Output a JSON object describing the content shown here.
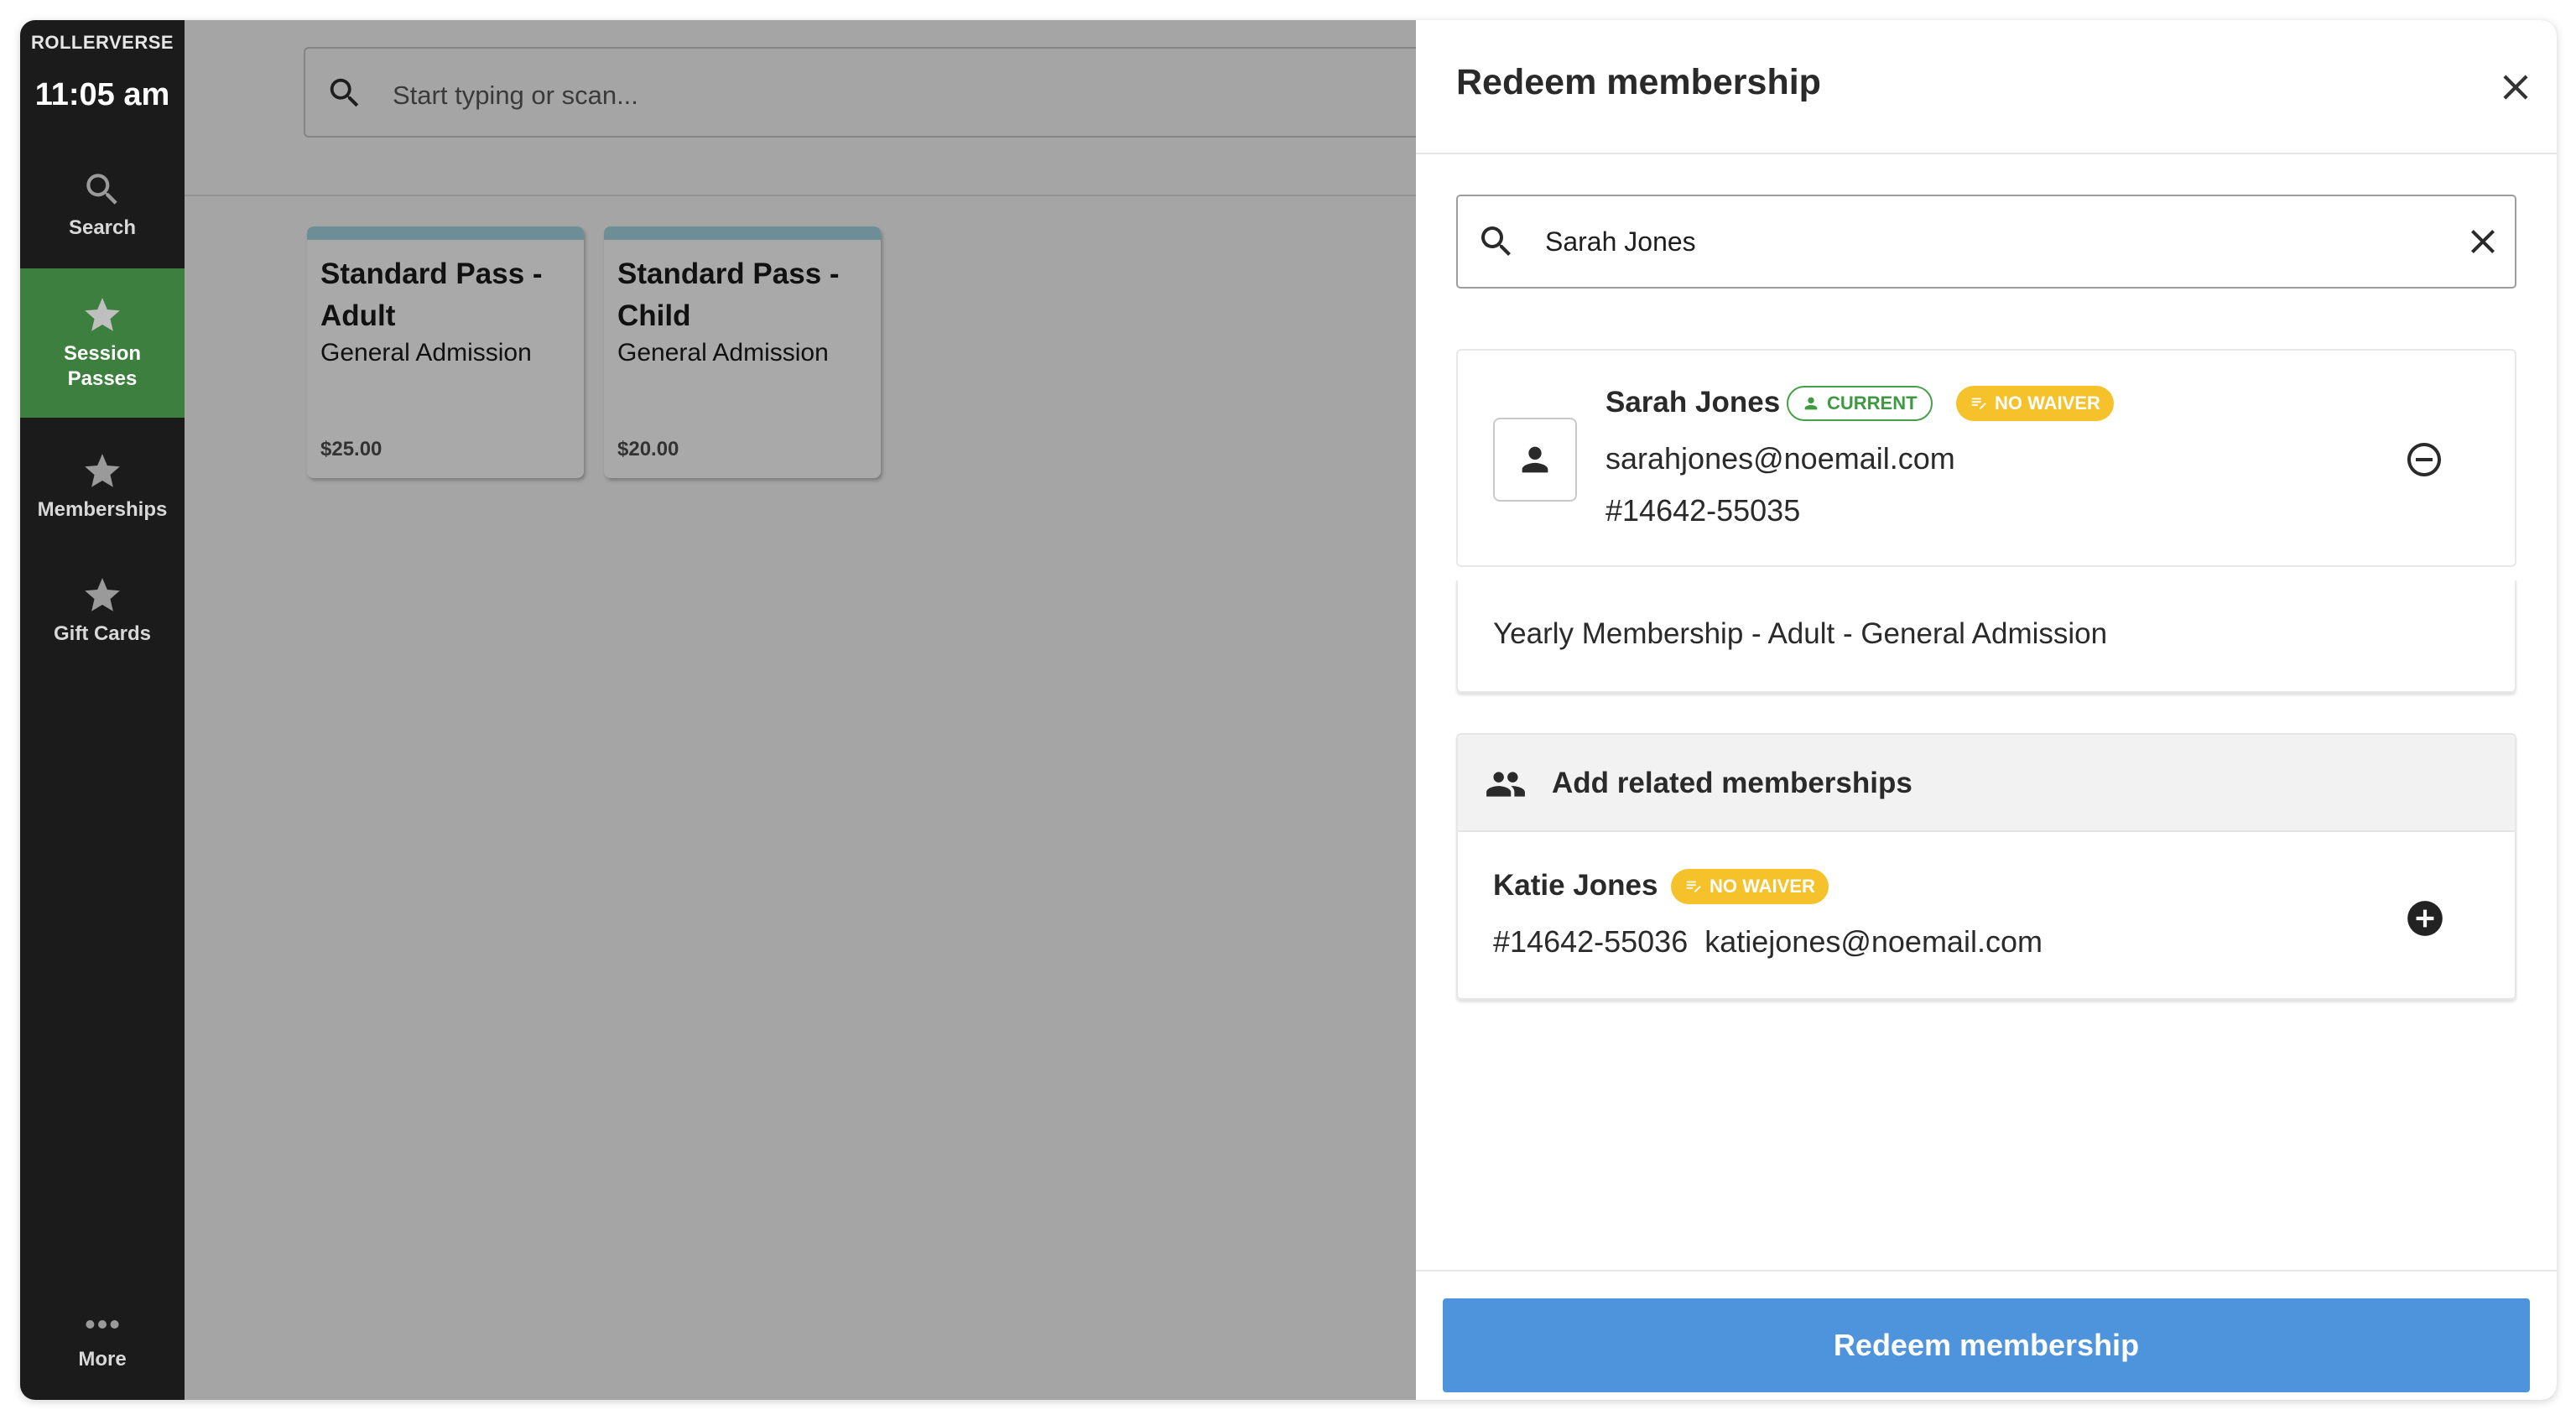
{
  "nav": {
    "brand": "ROLLERVERSE",
    "time": "11:05 am",
    "items": [
      {
        "label": "Search",
        "icon": "search-icon"
      },
      {
        "label": "Session Passes",
        "icon": "star-icon",
        "active": true
      },
      {
        "label": "Memberships",
        "icon": "star-icon"
      },
      {
        "label": "Gift Cards",
        "icon": "star-icon"
      }
    ],
    "more_label": "More"
  },
  "main": {
    "search_placeholder": "Start typing or scan...",
    "products": [
      {
        "name": "Standard Pass - Adult",
        "sub": "General Admission",
        "price": "$25.00"
      },
      {
        "name": "Standard Pass - Child",
        "sub": "General Admission",
        "price": "$20.00"
      }
    ]
  },
  "drawer": {
    "title": "Redeem membership",
    "search_value": "Sarah Jones",
    "member": {
      "name": "Sarah Jones",
      "badge_current": "CURRENT",
      "badge_waiver": "NO WAIVER",
      "email": "sarahjones@noemail.com",
      "id": "#14642-55035",
      "plan": "Yearly Membership - Adult - General Admission"
    },
    "related": {
      "heading": "Add related memberships",
      "items": [
        {
          "name": "Katie Jones",
          "badge": "NO WAIVER",
          "line": "#14642-55036  katiejones@noemail.com"
        }
      ]
    },
    "redeem_label": "Redeem membership"
  },
  "colors": {
    "nav_bg": "#1b1b1b",
    "nav_active": "#3c7f3e",
    "accent_button": "#4d94dc",
    "badge_current": "#45a049",
    "badge_waiver": "#f5c22b",
    "overlay": "#a5a5a5"
  }
}
